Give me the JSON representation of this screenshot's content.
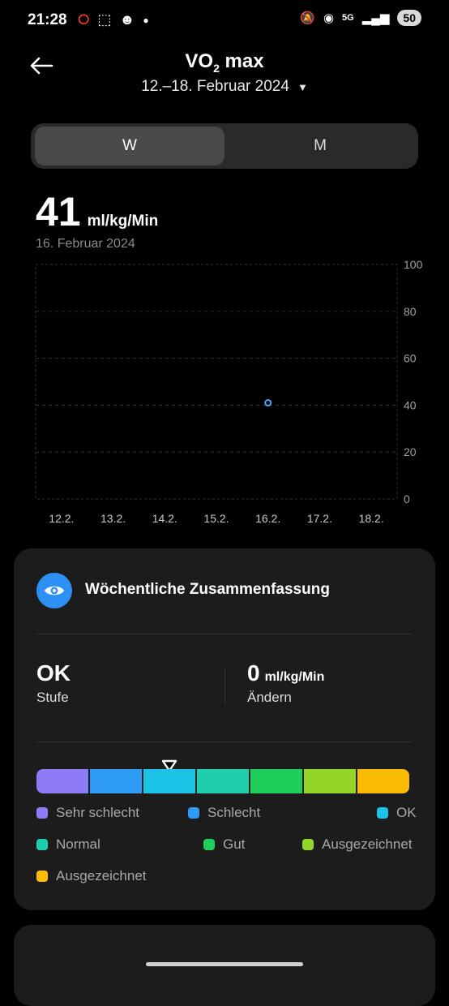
{
  "status_bar": {
    "time": "21:28",
    "battery": "50",
    "icons": [
      "opera-icon",
      "screenshot-icon",
      "discord-icon",
      "dot-icon",
      "mute-icon",
      "hotspot-icon",
      "5g-icon",
      "signal-icon"
    ]
  },
  "header": {
    "title": "VO",
    "title_sub": "2",
    "title_suffix": " max",
    "date_range": "12.–18. Februar 2024"
  },
  "tabs": [
    {
      "label": "W",
      "selected": true
    },
    {
      "label": "M",
      "selected": false
    }
  ],
  "current": {
    "value": "41",
    "unit": "ml/kg/Min",
    "date": "16. Februar 2024"
  },
  "chart_data": {
    "type": "scatter",
    "categories": [
      "12.2.",
      "13.2.",
      "14.2.",
      "15.2.",
      "16.2.",
      "17.2.",
      "18.2."
    ],
    "points": [
      {
        "x": "16.2.",
        "y": 41
      }
    ],
    "ylim": [
      0,
      100
    ],
    "yticks": [
      "0",
      "20",
      "40",
      "60",
      "80",
      "100"
    ],
    "grid": true,
    "point_color": "#4aa3ff"
  },
  "summary": {
    "title": "Wöchentliche Zusammenfassung",
    "level_value": "OK",
    "level_label": "Stufe",
    "change_value": "0",
    "change_unit": "ml/kg/Min",
    "change_label": "Ändern",
    "scale_colors": [
      "#8d7cf6",
      "#2e9bf5",
      "#1bc3e6",
      "#1ecfae",
      "#1fcf5b",
      "#93d626",
      "#fbbb05"
    ],
    "marker_segment": 2,
    "legend": [
      {
        "label": "Sehr schlecht",
        "color": "#8d7cf6"
      },
      {
        "label": "Schlecht",
        "color": "#2e9bf5"
      },
      {
        "label": "OK",
        "color": "#1bc3e6"
      },
      {
        "label": "Normal",
        "color": "#1ecfae"
      },
      {
        "label": "Gut",
        "color": "#1fcf5b"
      },
      {
        "label": "Ausgezeichnet",
        "color": "#93d626"
      },
      {
        "label": "Ausgezeichnet",
        "color": "#fbbb05"
      }
    ]
  }
}
